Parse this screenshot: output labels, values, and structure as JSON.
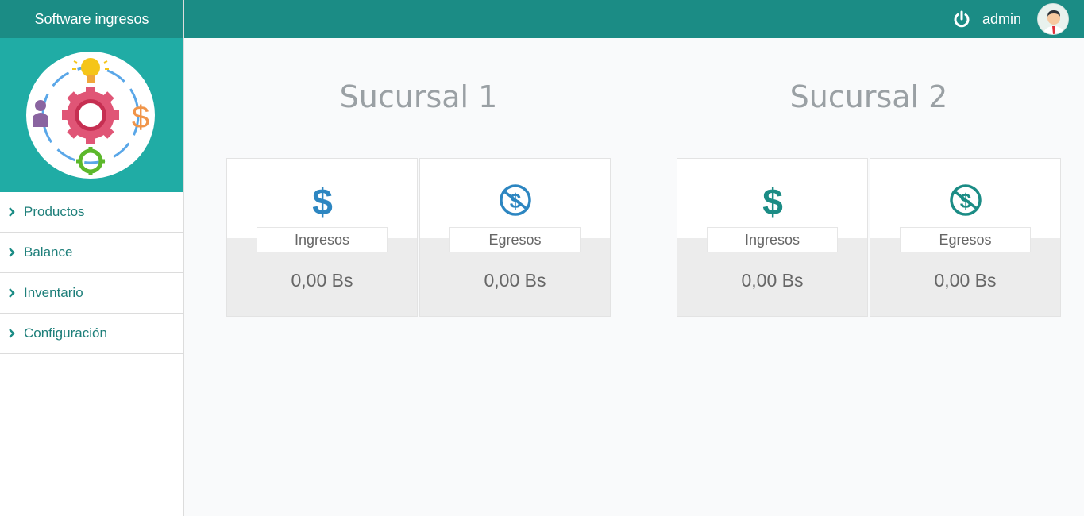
{
  "app": {
    "title": "Software ingresos"
  },
  "sidebar": {
    "items": [
      {
        "label": "Productos"
      },
      {
        "label": "Balance"
      },
      {
        "label": "Inventario"
      },
      {
        "label": "Configuración"
      }
    ]
  },
  "header": {
    "username": "admin",
    "icons": [
      "power-icon",
      "avatar"
    ]
  },
  "branches": [
    {
      "title": "Sucursal 1",
      "cards": [
        {
          "label": "Ingresos",
          "value": "0,00 Bs",
          "icon": "dollar-icon",
          "color": "#2d86c1"
        },
        {
          "label": "Egresos",
          "value": "0,00 Bs",
          "icon": "no-dollar-icon",
          "color": "#2d86c1"
        }
      ]
    },
    {
      "title": "Sucursal 2",
      "cards": [
        {
          "label": "Ingresos",
          "value": "0,00 Bs",
          "icon": "dollar-icon",
          "color": "#1b8c85"
        },
        {
          "label": "Egresos",
          "value": "0,00 Bs",
          "icon": "no-dollar-icon",
          "color": "#1b8c85"
        }
      ]
    }
  ],
  "colors": {
    "primary": "#1b8c85",
    "logo_bg": "#20aca5",
    "blue": "#2d86c1"
  }
}
